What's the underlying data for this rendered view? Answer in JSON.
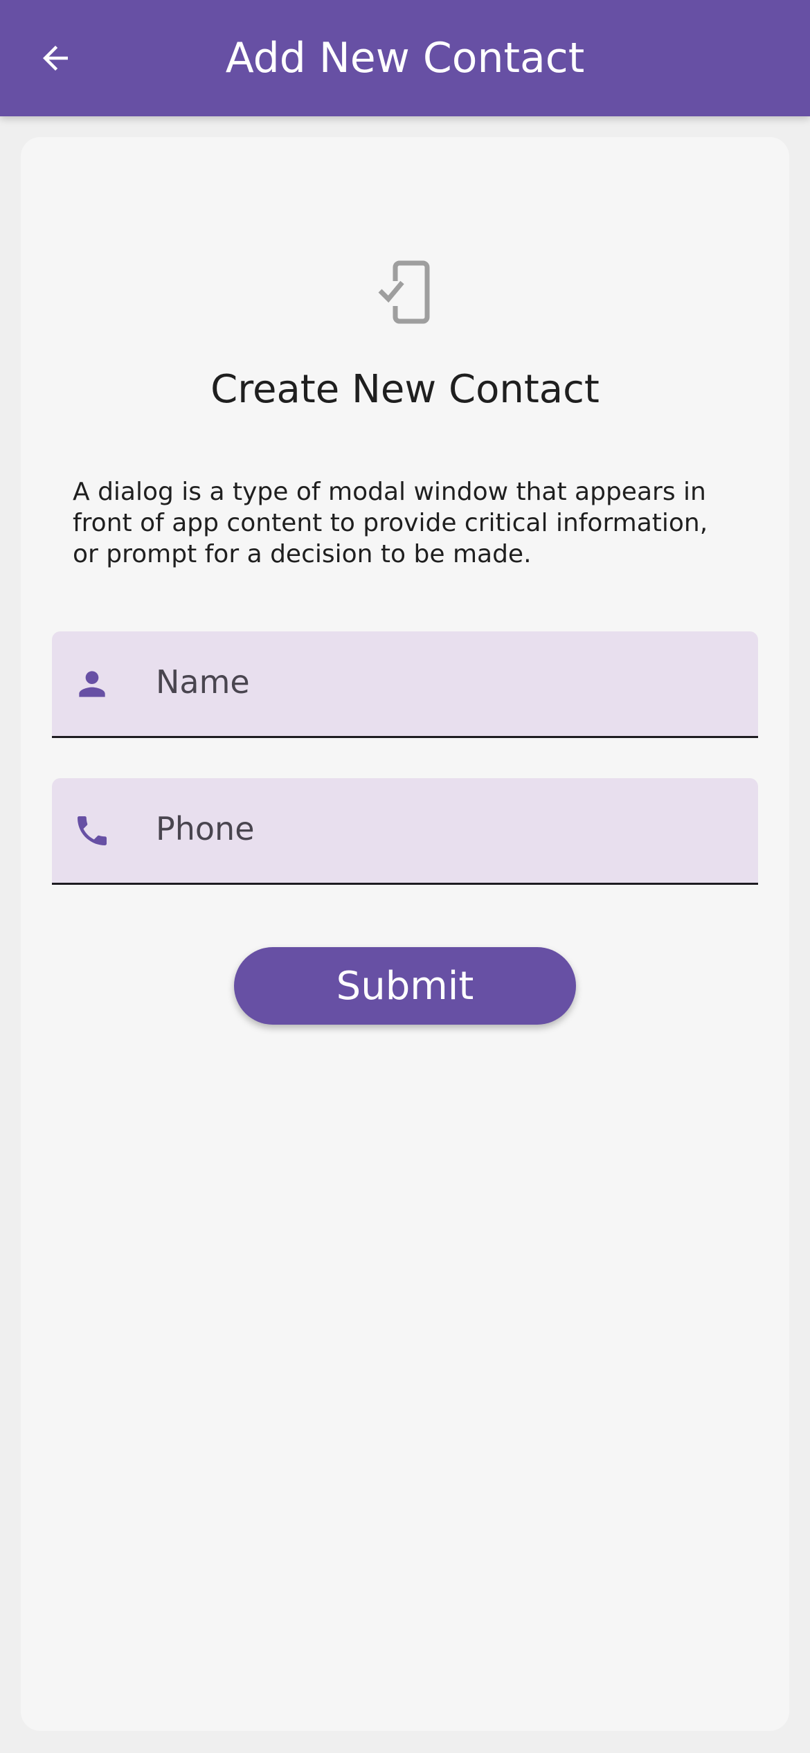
{
  "app_bar": {
    "title": "Add New Contact",
    "back_icon": "arrow-left-icon",
    "background": "#6750a4"
  },
  "card": {
    "icon": "phone-check-icon",
    "title": "Create New Contact",
    "description": "A dialog is a type of modal window that appears in front of app content to provide critical information, or prompt for a decision to be made."
  },
  "form": {
    "name_field": {
      "icon": "person-icon",
      "placeholder": "Name",
      "value": ""
    },
    "phone_field": {
      "icon": "phone-icon",
      "placeholder": "Phone",
      "value": ""
    },
    "submit_label": "Submit"
  },
  "colors": {
    "primary": "#6750a4",
    "field_fill": "#e8dfee",
    "card_bg": "#f6f6f6",
    "page_bg": "#efefef",
    "icon_gray": "#9e9e9e"
  }
}
